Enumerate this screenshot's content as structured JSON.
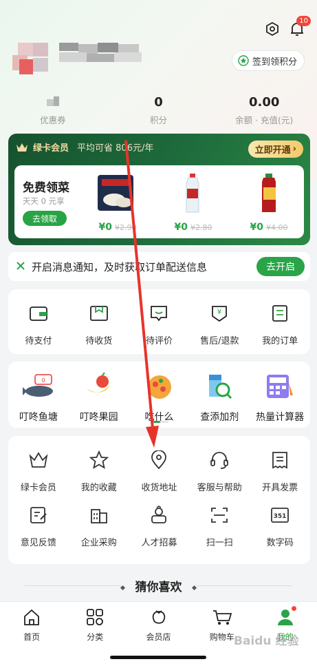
{
  "header": {
    "notification_count": "10",
    "signin_label": "签到领积分"
  },
  "stats": [
    {
      "value": "",
      "label": "优惠券"
    },
    {
      "value": "0",
      "label": "积分"
    },
    {
      "value": "0.00",
      "label": "余额 · 充值(元)"
    }
  ],
  "vip": {
    "title": "绿卡会员",
    "saving": "平均可省 806元/年",
    "open_button": "立即开通",
    "free_title": "免费领菜",
    "free_sub": "天天 0 元享",
    "claim_button": "去领取",
    "products": [
      {
        "name": "dumplings",
        "price": "¥0",
        "original": "¥2.90"
      },
      {
        "name": "water-bottle",
        "price": "¥0",
        "original": "¥2.80"
      },
      {
        "name": "herbal-tea",
        "price": "¥0",
        "original": "¥4.00"
      }
    ]
  },
  "notify": {
    "text": "开启消息通知，及时获取订单配送信息",
    "button": "去开启"
  },
  "orders": [
    {
      "icon": "wallet-icon",
      "label": "待支付"
    },
    {
      "icon": "package-icon",
      "label": "待收货"
    },
    {
      "icon": "comment-icon",
      "label": "待评价"
    },
    {
      "icon": "refund-icon",
      "label": "售后/退款"
    },
    {
      "icon": "order-list-icon",
      "label": "我的订单"
    }
  ],
  "tools": [
    {
      "icon": "fish-pond-icon",
      "label": "叮咚鱼塘"
    },
    {
      "icon": "orchard-icon",
      "label": "叮咚果园"
    },
    {
      "icon": "what-to-eat-icon",
      "label": "吃什么"
    },
    {
      "icon": "additive-check-icon",
      "label": "查添加剂"
    },
    {
      "icon": "calorie-calculator-icon",
      "label": "热量计算器"
    }
  ],
  "services": [
    {
      "icon": "crown-icon",
      "label": "绿卡会员"
    },
    {
      "icon": "star-icon",
      "label": "我的收藏"
    },
    {
      "icon": "location-icon",
      "label": "收货地址"
    },
    {
      "icon": "headset-icon",
      "label": "客服与帮助"
    },
    {
      "icon": "invoice-icon",
      "label": "开具发票"
    },
    {
      "icon": "feedback-icon",
      "label": "意见反馈"
    },
    {
      "icon": "enterprise-icon",
      "label": "企业采购"
    },
    {
      "icon": "recruit-icon",
      "label": "人才招募"
    },
    {
      "icon": "scan-icon",
      "label": "扫一扫"
    },
    {
      "icon": "digit-code-icon",
      "label": "数字码"
    }
  ],
  "guess_title": "猜你喜欢",
  "tabbar": [
    {
      "icon": "home-icon",
      "label": "首页"
    },
    {
      "icon": "category-icon",
      "label": "分类"
    },
    {
      "icon": "member-store-icon",
      "label": "会员店"
    },
    {
      "icon": "cart-icon",
      "label": "购物车"
    },
    {
      "icon": "profile-icon",
      "label": "我的"
    }
  ],
  "watermark": "Baidu 经验",
  "colors": {
    "accent": "#2aa448",
    "vip_bg": "#1e6b3c",
    "arrow": "#e8332a",
    "badge": "#f2463a"
  }
}
